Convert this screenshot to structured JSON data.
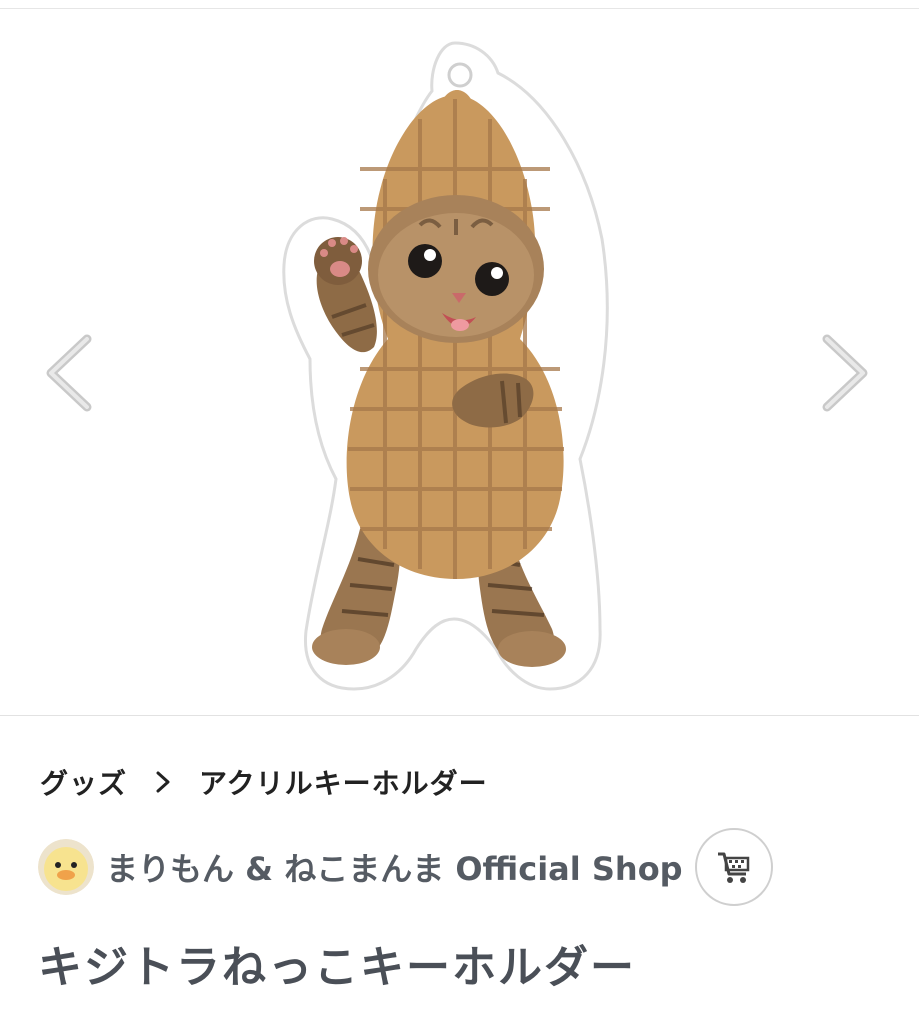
{
  "breadcrumb": {
    "category": "グッズ",
    "separator_icon": "chevron-right-icon",
    "subcategory": "アクリルキーホルダー"
  },
  "shop": {
    "name": "まりもん & ねこまんま Official Shop",
    "avatar_icon": "duckling-avatar",
    "cart_icon": "shopping-cart-icon"
  },
  "product": {
    "title": "キジトラねっこキーホルダー",
    "image_alt": "acrylic keychain of tabby kitten in peanut costume"
  },
  "gallery": {
    "prev_icon": "chevron-left-icon",
    "next_icon": "chevron-right-icon"
  },
  "colors": {
    "title_text": "#4a4f57",
    "shop_text": "#555b63",
    "arrow": "#c8c8c8",
    "peanut": "#c9995e"
  }
}
